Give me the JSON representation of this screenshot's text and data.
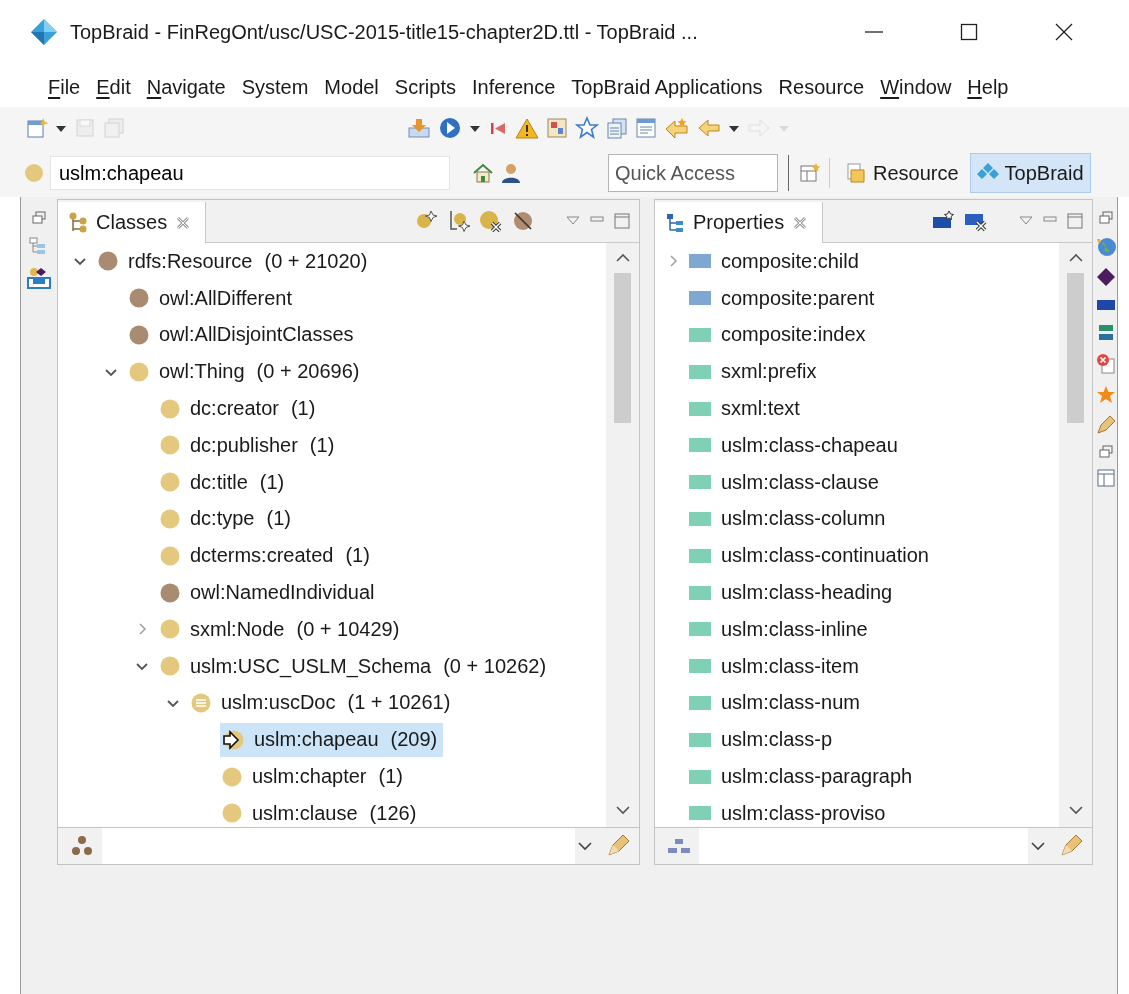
{
  "window": {
    "title": "TopBraid - FinRegOnt/usc/USC-2015-title15-chapter2D.ttl - TopBraid ..."
  },
  "menu": [
    {
      "label": "File",
      "mnemonic": true
    },
    {
      "label": "Edit",
      "mnemonic": true
    },
    {
      "label": "Navigate",
      "mnemonic": true
    },
    {
      "label": "System",
      "mnemonic": false
    },
    {
      "label": "Model",
      "mnemonic": false
    },
    {
      "label": "Scripts",
      "mnemonic": false
    },
    {
      "label": "Inference",
      "mnemonic": false
    },
    {
      "label": "TopBraid Applications",
      "mnemonic": false
    },
    {
      "label": "Resource",
      "mnemonic": false
    },
    {
      "label": "Window",
      "mnemonic": true
    },
    {
      "label": "Help",
      "mnemonic": true
    }
  ],
  "toolbar": {
    "left": [
      {
        "kind": "new-file",
        "disabled": false
      },
      {
        "kind": "caret",
        "disabled": false
      },
      {
        "kind": "save",
        "disabled": true
      },
      {
        "kind": "save-all",
        "disabled": true
      }
    ],
    "center": [
      {
        "kind": "import",
        "disabled": false
      },
      {
        "kind": "run",
        "disabled": false
      },
      {
        "kind": "caret",
        "disabled": false
      },
      {
        "kind": "first",
        "disabled": false
      },
      {
        "kind": "warning",
        "disabled": false
      },
      {
        "kind": "gallery",
        "disabled": false
      },
      {
        "kind": "star",
        "disabled": false
      },
      {
        "kind": "copy",
        "disabled": false
      },
      {
        "kind": "form",
        "disabled": false
      },
      {
        "kind": "back-star",
        "disabled": false
      },
      {
        "kind": "back",
        "disabled": false
      },
      {
        "kind": "caret",
        "disabled": false
      },
      {
        "kind": "forward",
        "disabled": true
      },
      {
        "kind": "caret",
        "disabled": true
      }
    ]
  },
  "resource_field": {
    "value": "uslm:chapeau"
  },
  "quick_access": {
    "placeholder": "Quick Access"
  },
  "perspectives": [
    {
      "label": "Resource",
      "selected": false
    },
    {
      "label": "TopBraid",
      "selected": true
    }
  ],
  "classes_view": {
    "tab": {
      "label": "Classes"
    },
    "tree": [
      {
        "label": "rdfs:Resource",
        "count": "(0 + 21020)",
        "kind": "class",
        "color": "#a88b70",
        "expanded": true,
        "selected": false,
        "children": [
          {
            "label": "owl:AllDifferent",
            "kind": "class",
            "color": "#a88b70",
            "selected": false
          },
          {
            "label": "owl:AllDisjointClasses",
            "kind": "class",
            "color": "#a88b70",
            "selected": false
          },
          {
            "label": "owl:Thing",
            "count": "(0 + 20696)",
            "kind": "class",
            "color": "#e3c87e",
            "expanded": true,
            "selected": false,
            "children": [
              {
                "label": "dc:creator",
                "count": "(1)",
                "kind": "class",
                "color": "#e3c87e",
                "selected": false
              },
              {
                "label": "dc:publisher",
                "count": "(1)",
                "kind": "class",
                "color": "#e3c87e",
                "selected": false
              },
              {
                "label": "dc:title",
                "count": "(1)",
                "kind": "class",
                "color": "#e3c87e",
                "selected": false
              },
              {
                "label": "dc:type",
                "count": "(1)",
                "kind": "class",
                "color": "#e3c87e",
                "selected": false
              },
              {
                "label": "dcterms:created",
                "count": "(1)",
                "kind": "class",
                "color": "#e3c87e",
                "selected": false
              },
              {
                "label": "owl:NamedIndividual",
                "kind": "class",
                "color": "#a88b70",
                "selected": false
              },
              {
                "label": "sxml:Node",
                "count": "(0 + 10429)",
                "kind": "class",
                "color": "#e3c87e",
                "expanded": false,
                "selected": false
              },
              {
                "label": "uslm:USC_USLM_Schema",
                "count": "(0 + 10262)",
                "kind": "class",
                "color": "#e3c87e",
                "expanded": true,
                "selected": false,
                "children": [
                  {
                    "label": "uslm:uscDoc",
                    "count": "(1 + 10261)",
                    "kind": "document-class",
                    "color": "#e3c87e",
                    "expanded": true,
                    "selected": false,
                    "children": [
                      {
                        "label": "uslm:chapeau",
                        "count": "(209)",
                        "kind": "current",
                        "color": "#e3c87e",
                        "selected": true
                      },
                      {
                        "label": "uslm:chapter",
                        "count": "(1)",
                        "kind": "class",
                        "color": "#e3c87e",
                        "selected": false
                      },
                      {
                        "label": "uslm:clause",
                        "count": "(126)",
                        "kind": "class",
                        "color": "#e3c87e",
                        "selected": false
                      }
                    ]
                  }
                ]
              }
            ]
          }
        ]
      }
    ]
  },
  "properties_view": {
    "tab": {
      "label": "Properties"
    },
    "tree": [
      {
        "label": "composite:child",
        "color": "#7ea8d2",
        "expanded": false,
        "selected": false
      },
      {
        "label": "composite:parent",
        "color": "#7ea8d2",
        "selected": false
      },
      {
        "label": "composite:index",
        "color": "#80d0b5",
        "selected": false
      },
      {
        "label": "sxml:prefix",
        "color": "#80d0b5",
        "selected": false
      },
      {
        "label": "sxml:text",
        "color": "#80d0b5",
        "selected": false
      },
      {
        "label": "uslm:class-chapeau",
        "color": "#80d0b5",
        "selected": false
      },
      {
        "label": "uslm:class-clause",
        "color": "#80d0b5",
        "selected": false
      },
      {
        "label": "uslm:class-column",
        "color": "#80d0b5",
        "selected": false
      },
      {
        "label": "uslm:class-continuation",
        "color": "#80d0b5",
        "selected": false
      },
      {
        "label": "uslm:class-heading",
        "color": "#80d0b5",
        "selected": false
      },
      {
        "label": "uslm:class-inline",
        "color": "#80d0b5",
        "selected": false
      },
      {
        "label": "uslm:class-item",
        "color": "#80d0b5",
        "selected": false
      },
      {
        "label": "uslm:class-num",
        "color": "#80d0b5",
        "selected": false
      },
      {
        "label": "uslm:class-p",
        "color": "#80d0b5",
        "selected": false
      },
      {
        "label": "uslm:class-paragraph",
        "color": "#80d0b5",
        "selected": false
      },
      {
        "label": "uslm:class-proviso",
        "color": "#80d0b5",
        "selected": false
      }
    ]
  }
}
